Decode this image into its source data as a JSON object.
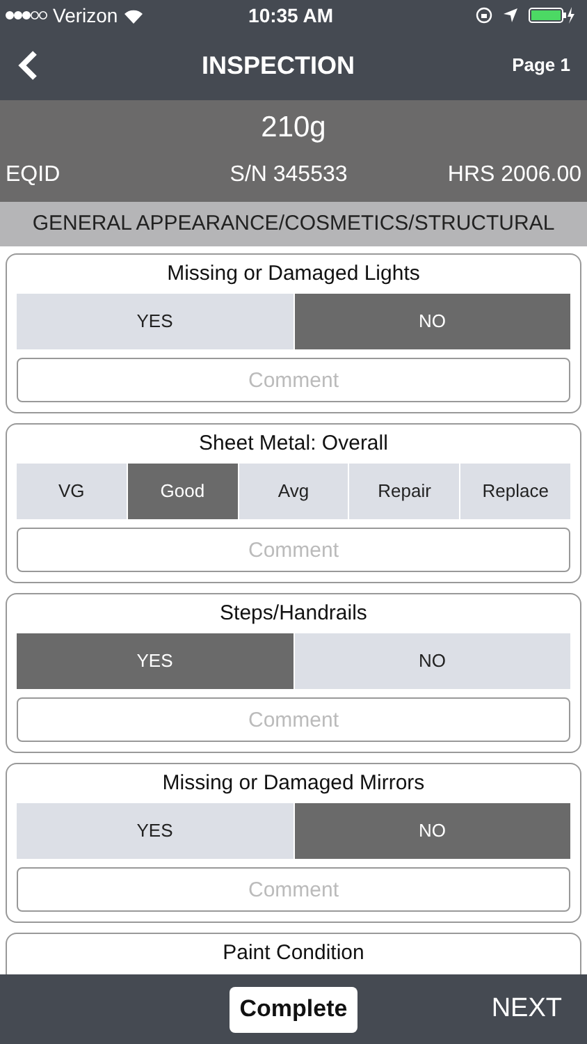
{
  "status_bar": {
    "carrier": "Verizon",
    "time": "10:35 AM"
  },
  "nav": {
    "title": "INSPECTION",
    "page": "Page 1"
  },
  "equipment": {
    "model": "210g",
    "eqid": "EQID",
    "serial": "S/N 345533",
    "hours": "HRS 2006.00"
  },
  "section": {
    "title": "GENERAL APPEARANCE/COSMETICS/STRUCTURAL"
  },
  "questions": [
    {
      "title": "Missing or Damaged Lights",
      "options": [
        {
          "label": "YES",
          "selected": false
        },
        {
          "label": "NO",
          "selected": true
        }
      ],
      "comment": {
        "placeholder": "Comment"
      }
    },
    {
      "title": "Sheet Metal: Overall",
      "options": [
        {
          "label": "VG",
          "selected": false
        },
        {
          "label": "Good",
          "selected": true
        },
        {
          "label": "Avg",
          "selected": false
        },
        {
          "label": "Repair",
          "selected": false
        },
        {
          "label": "Replace",
          "selected": false
        }
      ],
      "comment": {
        "placeholder": "Comment"
      }
    },
    {
      "title": "Steps/Handrails",
      "options": [
        {
          "label": "YES",
          "selected": true
        },
        {
          "label": "NO",
          "selected": false
        }
      ],
      "comment": {
        "placeholder": "Comment"
      }
    },
    {
      "title": "Missing or Damaged Mirrors",
      "options": [
        {
          "label": "YES",
          "selected": false
        },
        {
          "label": "NO",
          "selected": true
        }
      ],
      "comment": {
        "placeholder": "Comment"
      }
    },
    {
      "title": "Paint Condition"
    }
  ],
  "footer": {
    "complete": "Complete",
    "next": "NEXT"
  }
}
